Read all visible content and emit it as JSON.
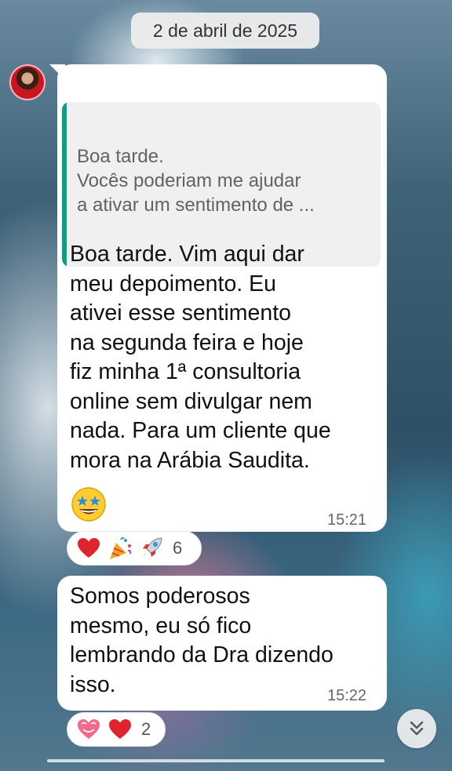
{
  "date_separator": "2 de abril de 2025",
  "message1": {
    "quote_lines": [
      "Boa tarde.",
      "Vocês poderiam me ajudar",
      "a ativar um sentimento de ..."
    ],
    "text_lines": [
      "Boa tarde. Vim aqui dar",
      "meu depoimento. Eu",
      "ativei esse sentimento",
      "na segunda feira e hoje",
      "fiz minha 1ª consultoria",
      "online sem divulgar nem",
      "nada. Para um cliente que",
      "mora na Arábia Saudita."
    ],
    "emoji": "star-struck-emoji",
    "time": "15:21",
    "reactions": {
      "icons": [
        "red-heart-icon",
        "party-popper-icon",
        "rocket-icon"
      ],
      "count": "6"
    }
  },
  "message2": {
    "text_lines": [
      "Somos poderosos",
      "mesmo, eu só fico",
      "lembrando da Dra dizendo",
      "isso."
    ],
    "time": "15:22",
    "reactions": {
      "icons": [
        "sparkling-heart-icon",
        "red-heart-icon"
      ],
      "count": "2"
    }
  },
  "colors": {
    "quote_accent": "#06a084",
    "bubble_bg": "#ffffff",
    "heart_red": "#e0242e"
  },
  "scroll_button_icon": "double-chevron-down-icon"
}
